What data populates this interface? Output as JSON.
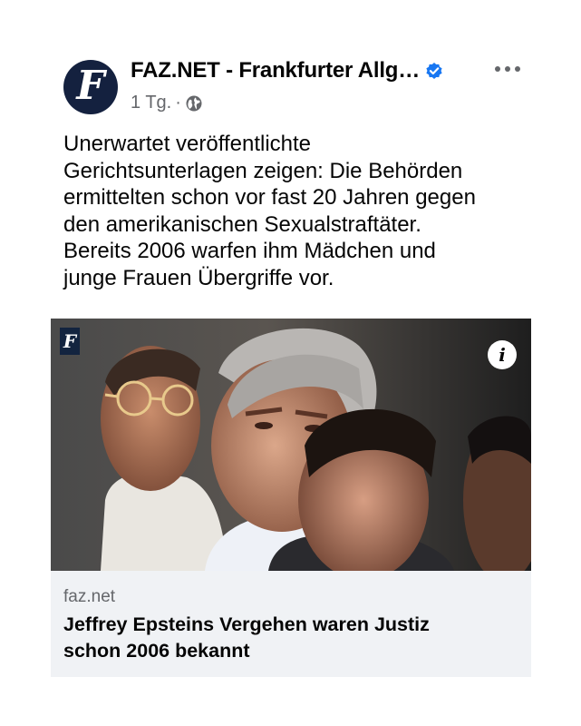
{
  "post": {
    "page_name": "FAZ.NET - Frankfurter Allg…",
    "avatar_letter": "F",
    "time": "1 Tg.",
    "separator": "·",
    "audience_icon": "globe-icon",
    "verified_icon": "verified-badge-icon",
    "more_icon": "more-options-icon",
    "text_lines": [
      "Unerwartet veröffentlichte",
      "Gerichtsunterlagen zeigen: Die Behörden",
      "ermittelten schon vor fast 20 Jahren gegen",
      "den amerikanischen Sexualstraftäter.",
      "Bereits 2006 warfen ihm Mädchen und",
      "junge Frauen Übergriffe vor."
    ]
  },
  "media": {
    "logo_letter": "F",
    "info_label": "i"
  },
  "link": {
    "domain": "faz.net",
    "title_lines": [
      "Jeffrey Epsteins Vergehen waren Justiz",
      "schon 2006 bekannt"
    ]
  },
  "colors": {
    "verified_blue": "#1877f2",
    "secondary_text": "#65676b",
    "link_card_bg": "#f0f2f5",
    "brand_navy": "#14213f"
  }
}
